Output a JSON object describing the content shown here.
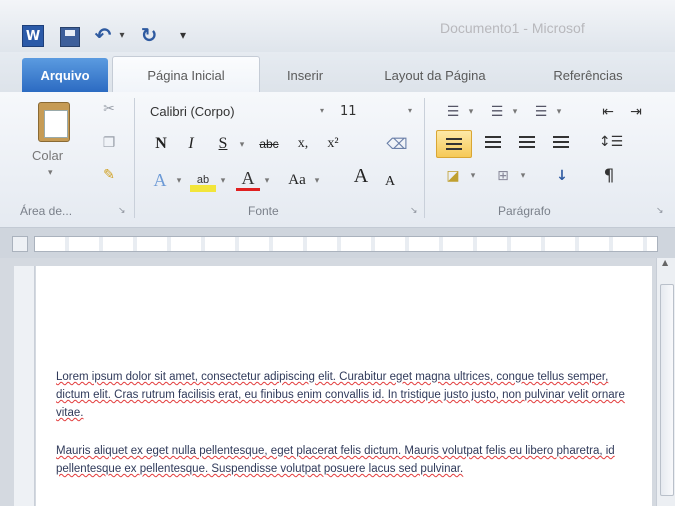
{
  "window": {
    "title": "Documento1 - Microsof",
    "qat": {
      "app_icon": "W"
    }
  },
  "tabs": [
    {
      "label": "Arquivo"
    },
    {
      "label": "Página Inicial"
    },
    {
      "label": "Inserir"
    },
    {
      "label": "Layout da Página"
    },
    {
      "label": "Referências"
    }
  ],
  "ribbon": {
    "clipboard": {
      "paste_label": "Colar",
      "group_label": "Área de..."
    },
    "font": {
      "font_name": "Calibri (Corpo)",
      "font_size": "11",
      "bold": "N",
      "italic": "I",
      "underline": "S",
      "strike": "abc",
      "subscript": "x,",
      "superscript": "x²",
      "case": "Aa",
      "grow": "A",
      "shrink": "A",
      "group_label": "Fonte"
    },
    "paragraph": {
      "group_label": "Parágrafo",
      "sort": "↓",
      "pilcrow": "¶"
    }
  },
  "document": {
    "paragraphs": [
      "Lorem ipsum dolor sit amet, consectetur adipiscing elit. Curabitur eget magna ultrices, congue tellus semper, dictum elit. Cras rutrum facilisis erat, eu finibus enim convallis id. In tristique justo justo, non pulvinar velit ornare vitae.",
      "Mauris aliquet ex eget nulla pellentesque, eget placerat felis dictum. Mauris volutpat felis eu libero pharetra, id pellentesque ex pellentesque. Suspendisse volutpat posuere lacus sed pulvinar."
    ]
  }
}
